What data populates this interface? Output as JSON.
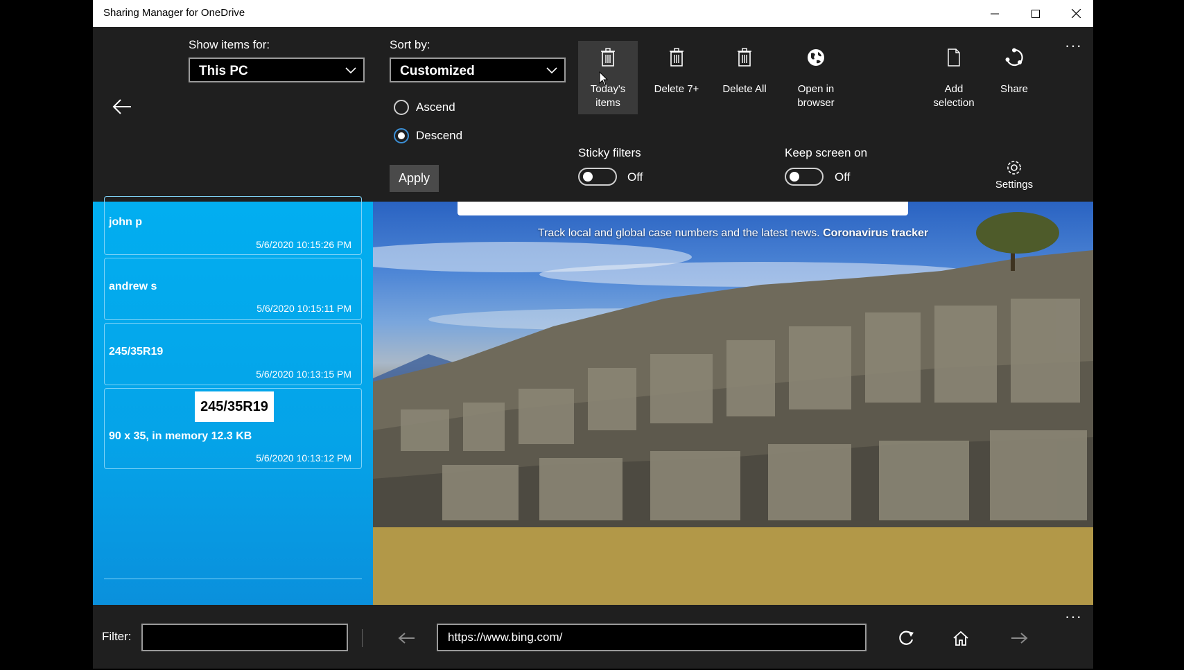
{
  "window": {
    "title": "Sharing Manager for OneDrive",
    "controls": [
      "minimize",
      "maximize",
      "close"
    ]
  },
  "toolbar": {
    "show_items_label": "Show items for:",
    "show_items_value": "This PC",
    "sort_label": "Sort by:",
    "sort_value": "Customized",
    "ascend_label": "Ascend",
    "descend_label": "Descend",
    "sort_order_selected": "Descend",
    "apply_label": "Apply",
    "buttons": [
      {
        "id": "todays-items",
        "label_line1": "Today's",
        "label_line2": "items",
        "icon": "trash-icon"
      },
      {
        "id": "delete-7",
        "label_line1": "Delete 7+",
        "label_line2": "",
        "icon": "trash-icon"
      },
      {
        "id": "delete-all",
        "label_line1": "Delete All",
        "label_line2": "",
        "icon": "trash-icon"
      },
      {
        "id": "open-browser",
        "label_line1": "Open in",
        "label_line2": "browser",
        "icon": "globe-icon"
      },
      {
        "id": "add-selection",
        "label_line1": "Add",
        "label_line2": "selection",
        "icon": "document-icon"
      },
      {
        "id": "share",
        "label_line1": "Share",
        "label_line2": "",
        "icon": "share-icon"
      }
    ],
    "sticky_filters_label": "Sticky filters",
    "sticky_filters_state": "Off",
    "keep_screen_label": "Keep screen on",
    "keep_screen_state": "Off",
    "settings_label": "Settings"
  },
  "items": [
    {
      "name": "john p",
      "time": "5/6/2020 10:15:26 PM"
    },
    {
      "name": "andrew s",
      "time": "5/6/2020 10:15:11 PM"
    },
    {
      "name": "245/35R19",
      "time": "5/6/2020 10:13:15 PM"
    },
    {
      "thumb_text": "245/35R19",
      "meta": "90 x 35, in memory 12.3 KB",
      "time": "5/6/2020 10:13:12 PM"
    }
  ],
  "browser": {
    "tracker_text": "Track local and global case numbers and the latest news.",
    "tracker_link": "Coronavirus tracker",
    "url": "https://www.bing.com/"
  },
  "bottom": {
    "filter_label": "Filter:",
    "filter_value": ""
  },
  "colors": {
    "list_blue": "#02aef0",
    "toolbar_bg": "#1f1f1f",
    "accent": "#3b8fd6"
  }
}
